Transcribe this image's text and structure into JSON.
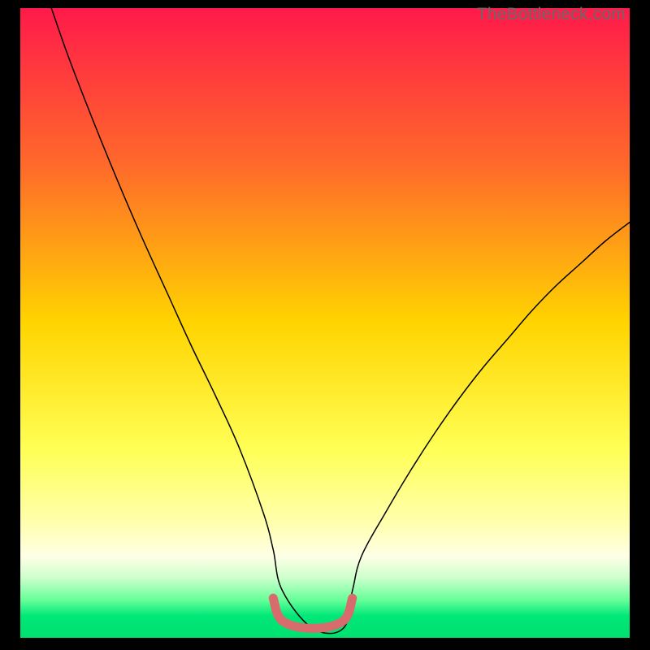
{
  "watermark": "TheBottleneck.com",
  "chart_data": {
    "type": "line",
    "title": "",
    "xlabel": "",
    "ylabel": "",
    "xlim": [
      0,
      100
    ],
    "ylim": [
      0,
      100
    ],
    "gradient_stops": [
      {
        "offset": 0.0,
        "color": "#ff1a4a"
      },
      {
        "offset": 0.25,
        "color": "#ff6a2a"
      },
      {
        "offset": 0.5,
        "color": "#ffd400"
      },
      {
        "offset": 0.7,
        "color": "#ffff55"
      },
      {
        "offset": 0.82,
        "color": "#ffffb0"
      },
      {
        "offset": 0.87,
        "color": "#ffffe6"
      },
      {
        "offset": 0.905,
        "color": "#ccffcc"
      },
      {
        "offset": 0.94,
        "color": "#66ff99"
      },
      {
        "offset": 0.965,
        "color": "#00e878"
      },
      {
        "offset": 1.0,
        "color": "#00e070"
      }
    ],
    "series": [
      {
        "name": "main-curve",
        "stroke": "#000000",
        "stroke_width": 1.5,
        "x": [
          5.1,
          8,
          12,
          16,
          20,
          24,
          28,
          32,
          36,
          40,
          41.5,
          43,
          48,
          53,
          54.5,
          56,
          60,
          64,
          68,
          72,
          76,
          80,
          84,
          88,
          92,
          96,
          100
        ],
        "y": [
          100,
          92,
          82,
          72.5,
          63.5,
          55,
          46.5,
          38.5,
          30,
          19.5,
          14,
          7.5,
          1.5,
          1.5,
          7.5,
          13,
          20,
          26.5,
          32.5,
          38,
          43,
          47.5,
          52,
          56,
          59.5,
          63,
          66
        ]
      },
      {
        "name": "flat-marker",
        "stroke": "#d86b6b",
        "stroke_width": 11,
        "linecap": "round",
        "x": [
          41.5,
          43,
          48,
          53,
          54.5
        ],
        "y": [
          6.3,
          2.7,
          1.5,
          2.7,
          6.3
        ]
      }
    ]
  }
}
